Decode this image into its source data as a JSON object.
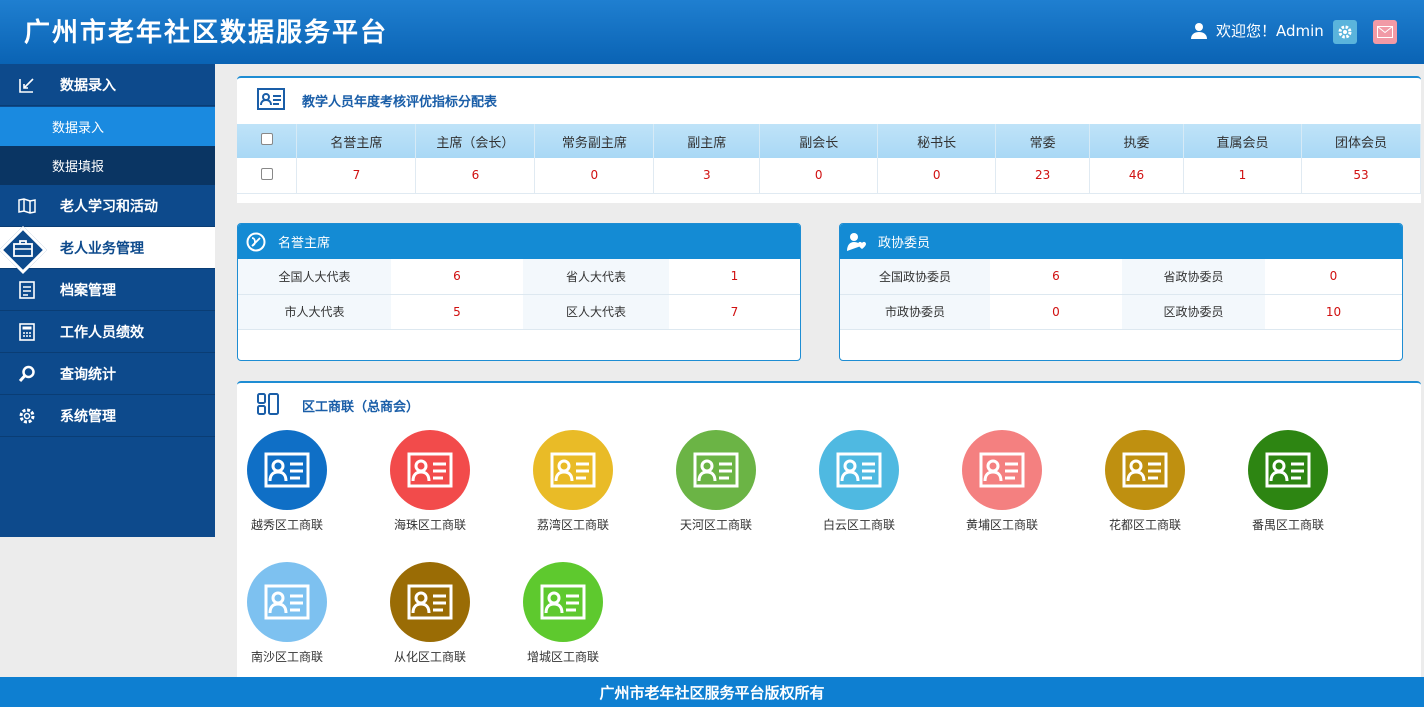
{
  "header": {
    "title": "广州市老年社区数据服务平台",
    "welcome": "欢迎您！Admin"
  },
  "sidebar": {
    "items": [
      {
        "label": "数据录入",
        "icon": "edit-icon"
      },
      {
        "label": "老人学习和活动",
        "icon": "map-icon"
      },
      {
        "label": "老人业务管理",
        "icon": "briefcase-icon"
      },
      {
        "label": "档案管理",
        "icon": "archive-icon"
      },
      {
        "label": "工作人员绩效",
        "icon": "calculator-icon"
      },
      {
        "label": "查询统计",
        "icon": "search-icon"
      },
      {
        "label": "系统管理",
        "icon": "gear-icon"
      }
    ],
    "subitems": [
      "数据录入",
      "数据填报"
    ]
  },
  "assessment": {
    "title": "教学人员年度考核评优指标分配表",
    "headers": [
      "名誉主席",
      "主席（会长）",
      "常务副主席",
      "副主席",
      "副会长",
      "秘书长",
      "常委",
      "执委",
      "直属会员",
      "团体会员"
    ],
    "values": [
      "7",
      "6",
      "0",
      "3",
      "0",
      "0",
      "23",
      "46",
      "1",
      "53"
    ]
  },
  "honorary": {
    "title": "名誉主席",
    "rows": [
      {
        "l1": "全国人大代表",
        "v1": "6",
        "l2": "省人大代表",
        "v2": "1"
      },
      {
        "l1": "市人大代表",
        "v1": "5",
        "l2": "区人大代表",
        "v2": "7"
      }
    ]
  },
  "cppcc": {
    "title": "政协委员",
    "rows": [
      {
        "l1": "全国政协委员",
        "v1": "6",
        "l2": "省政协委员",
        "v2": "0"
      },
      {
        "l1": "市政协委员",
        "v1": "0",
        "l2": "区政协委员",
        "v2": "10"
      }
    ]
  },
  "federation": {
    "title": "区工商联（总商会）",
    "items": [
      {
        "label": "越秀区工商联",
        "color": "#0f6fc6"
      },
      {
        "label": "海珠区工商联",
        "color": "#f24b4b"
      },
      {
        "label": "荔湾区工商联",
        "color": "#e9bb27"
      },
      {
        "label": "天河区工商联",
        "color": "#6bb445"
      },
      {
        "label": "白云区工商联",
        "color": "#4fb9e1"
      },
      {
        "label": "黄埔区工商联",
        "color": "#f48080"
      },
      {
        "label": "花都区工商联",
        "color": "#bf9010"
      },
      {
        "label": "番禺区工商联",
        "color": "#2d8512"
      },
      {
        "label": "南沙区工商联",
        "color": "#7dc1f0"
      },
      {
        "label": "从化区工商联",
        "color": "#9a6c05"
      },
      {
        "label": "增城区工商联",
        "color": "#5ec92e"
      }
    ]
  },
  "footer": {
    "text": "广州市老年社区服务平台版权所有"
  }
}
